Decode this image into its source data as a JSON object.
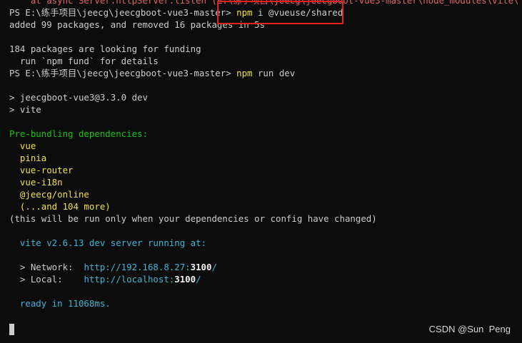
{
  "terminal": {
    "lines": [
      {
        "segments": [
          {
            "text": "    at async Server.httpServer.listen (E:\\练手项目\\jeecg\\jeecgboot-vue3-master\\node_modules\\vite\\dist\\n",
            "color": "red"
          }
        ]
      },
      {
        "segments": [
          {
            "text": "PS E:\\练手项目\\jeecg\\jeecgboot-vue3-master> ",
            "color": "default"
          },
          {
            "text": "npm",
            "color": "yellow"
          },
          {
            "text": " i @vueuse/shared",
            "color": "default"
          }
        ]
      },
      {
        "segments": [
          {
            "text": "added 99 packages, and removed 16 packages in 5s",
            "color": "default"
          }
        ]
      },
      {
        "segments": []
      },
      {
        "segments": [
          {
            "text": "184 packages are looking for funding",
            "color": "default"
          }
        ]
      },
      {
        "segments": [
          {
            "text": "  run `npm fund` for details",
            "color": "default"
          }
        ]
      },
      {
        "segments": [
          {
            "text": "PS E:\\练手项目\\jeecg\\jeecgboot-vue3-master> ",
            "color": "default"
          },
          {
            "text": "npm",
            "color": "yellow"
          },
          {
            "text": " run dev",
            "color": "default"
          }
        ]
      },
      {
        "segments": []
      },
      {
        "segments": [
          {
            "text": "> jeecgboot-vue3@3.3.0 dev",
            "color": "default"
          }
        ]
      },
      {
        "segments": [
          {
            "text": "> vite",
            "color": "default"
          }
        ]
      },
      {
        "segments": []
      },
      {
        "segments": [
          {
            "text": "Pre-bundling dependencies:",
            "color": "green"
          }
        ]
      },
      {
        "segments": [
          {
            "text": "  vue",
            "color": "yellow"
          }
        ]
      },
      {
        "segments": [
          {
            "text": "  pinia",
            "color": "yellow"
          }
        ]
      },
      {
        "segments": [
          {
            "text": "  vue-router",
            "color": "yellow"
          }
        ]
      },
      {
        "segments": [
          {
            "text": "  vue-i18n",
            "color": "yellow"
          }
        ]
      },
      {
        "segments": [
          {
            "text": "  @jeecg/online",
            "color": "yellow"
          }
        ]
      },
      {
        "segments": [
          {
            "text": "  (...and 104 more)",
            "color": "yellow"
          }
        ]
      },
      {
        "segments": [
          {
            "text": "(this will be run only when your dependencies or config have changed)",
            "color": "default"
          }
        ]
      },
      {
        "segments": []
      },
      {
        "segments": [
          {
            "text": "  vite v2.6.13 dev server running at:",
            "color": "cyan"
          }
        ]
      },
      {
        "segments": []
      },
      {
        "segments": [
          {
            "text": "  > Network:  ",
            "color": "default"
          },
          {
            "text": "http://192.168.8.27:",
            "color": "cyan"
          },
          {
            "text": "3100",
            "color": "bold"
          },
          {
            "text": "/",
            "color": "cyan"
          }
        ]
      },
      {
        "segments": [
          {
            "text": "  > Local:    ",
            "color": "default"
          },
          {
            "text": "http://localhost:",
            "color": "cyan"
          },
          {
            "text": "3100",
            "color": "bold"
          },
          {
            "text": "/",
            "color": "cyan"
          }
        ]
      },
      {
        "segments": []
      },
      {
        "segments": [
          {
            "text": "  ready in 11068ms.",
            "color": "cyan"
          }
        ]
      }
    ]
  },
  "colors": {
    "background": "#0c0c0c",
    "default": "#cccccc",
    "red": "#e06666",
    "yellow": "#f0e04a",
    "green": "#16c60c",
    "cyan": "#3fb6d6",
    "highlight_border": "#e22020"
  },
  "watermark": "CSDN @Sun  Peng"
}
